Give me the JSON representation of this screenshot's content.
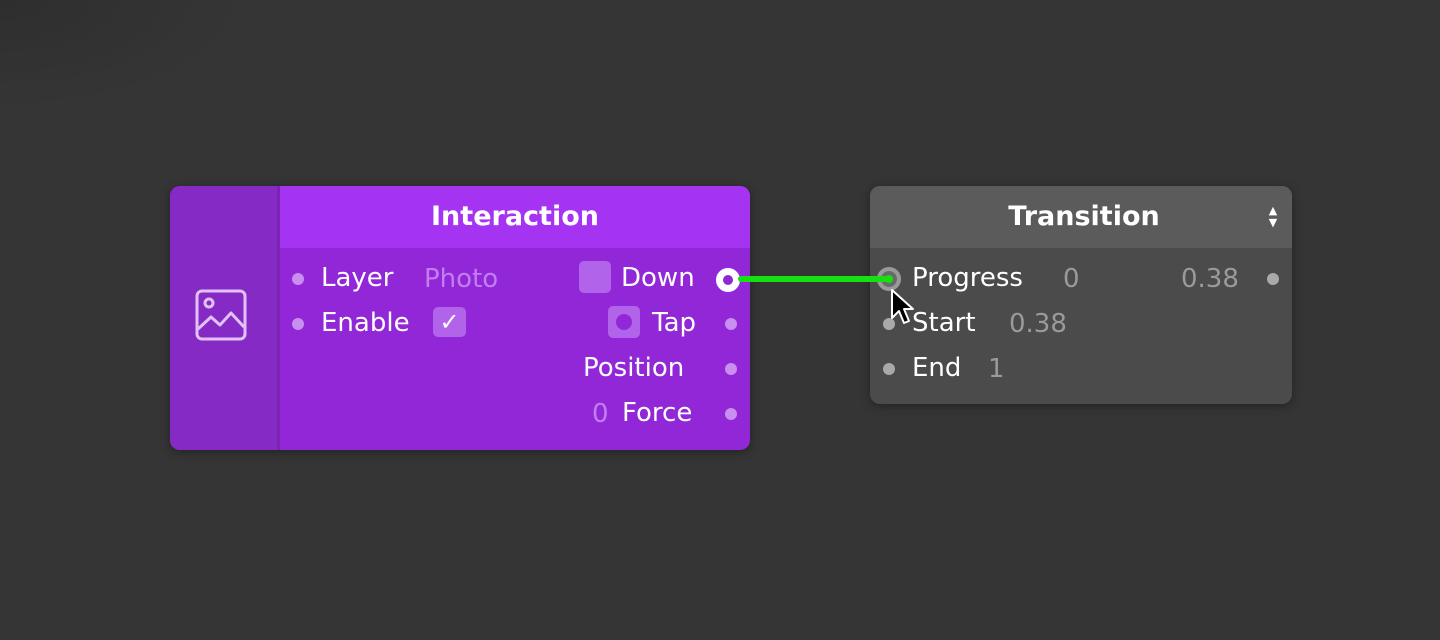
{
  "colors": {
    "canvas": "#353535",
    "interaction_header": "#a434f1",
    "interaction_body": "#9227d8",
    "transition_header": "#5b5b5b",
    "transition_body": "#4b4b4b",
    "connection": "#16e00f"
  },
  "interaction": {
    "title": "Interaction",
    "thumbnail_icon": "image-icon",
    "inputs": [
      {
        "label": "Layer",
        "value": "Photo"
      },
      {
        "label": "Enable",
        "value": "✓"
      }
    ],
    "outputs": [
      {
        "label": "Down",
        "value": "",
        "connected": true
      },
      {
        "label": "Tap",
        "value": ""
      },
      {
        "label": "Position",
        "value": ""
      },
      {
        "label": "Force",
        "value": "0"
      }
    ]
  },
  "transition": {
    "title": "Transition",
    "stepper_icon": "up-down-stepper-icon",
    "inputs": [
      {
        "label": "Progress",
        "value": "0",
        "connected": true
      },
      {
        "label": "Start",
        "value": "0.38"
      },
      {
        "label": "End",
        "value": "1"
      }
    ],
    "output_value": "0.38"
  },
  "connection": {
    "from": "Interaction.Down",
    "to": "Transition.Progress"
  }
}
